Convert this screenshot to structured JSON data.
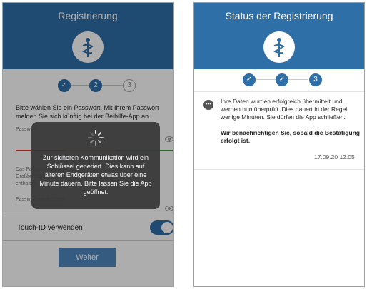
{
  "left": {
    "header_title": "Registrierung",
    "steps": [
      "✓",
      "2",
      "3"
    ],
    "instruction": "Bitte wählen Sie ein Passwort. Mit Ihrem Passwort melden Sie sich künftig bei der Beihilfe-App an.",
    "password_label": "Passwort",
    "hint_line1": "Das Passwort muss mind.",
    "hint_line2": "Großbuchstaben, Kleinbuchstaben und Zahl",
    "hint_line3": "enthalten.",
    "repeat_label": "Passwort wiederholen",
    "touch_id_label": "Touch-ID verwenden",
    "touch_id_enabled": true,
    "next_button": "Weiter",
    "overlay_message": "Zur sicheren Kommunikation wird ein Schlüssel generiert. Dies kann auf älteren Endgeräten etwas über eine Minute dauern. Bitte lassen Sie die App geöffnet.",
    "strength_colors": [
      "#d9342b",
      "#f0a31b",
      "#3d9b3d"
    ]
  },
  "right": {
    "header_title": "Status der Registrierung",
    "steps": [
      "✓",
      "✓",
      "3"
    ],
    "message": "Ihre Daten wurden erfolgreich übermittelt und werden nun überprüft. Dies dauert in der Regel wenige Minuten. Sie dürfen die App schließen.",
    "notice": "Wir benachrichtigen Sie, sobald die Bestätigung erfolgt ist.",
    "timestamp": "17.09.20 12:05"
  },
  "colors": {
    "accent": "#2f6fa8",
    "button": "#4f87bd"
  },
  "icons": {
    "logo": "caduceus-logo-icon",
    "check": "check-icon",
    "eye": "eye-icon",
    "info": "info-dots-icon",
    "spinner": "spinner-icon"
  }
}
